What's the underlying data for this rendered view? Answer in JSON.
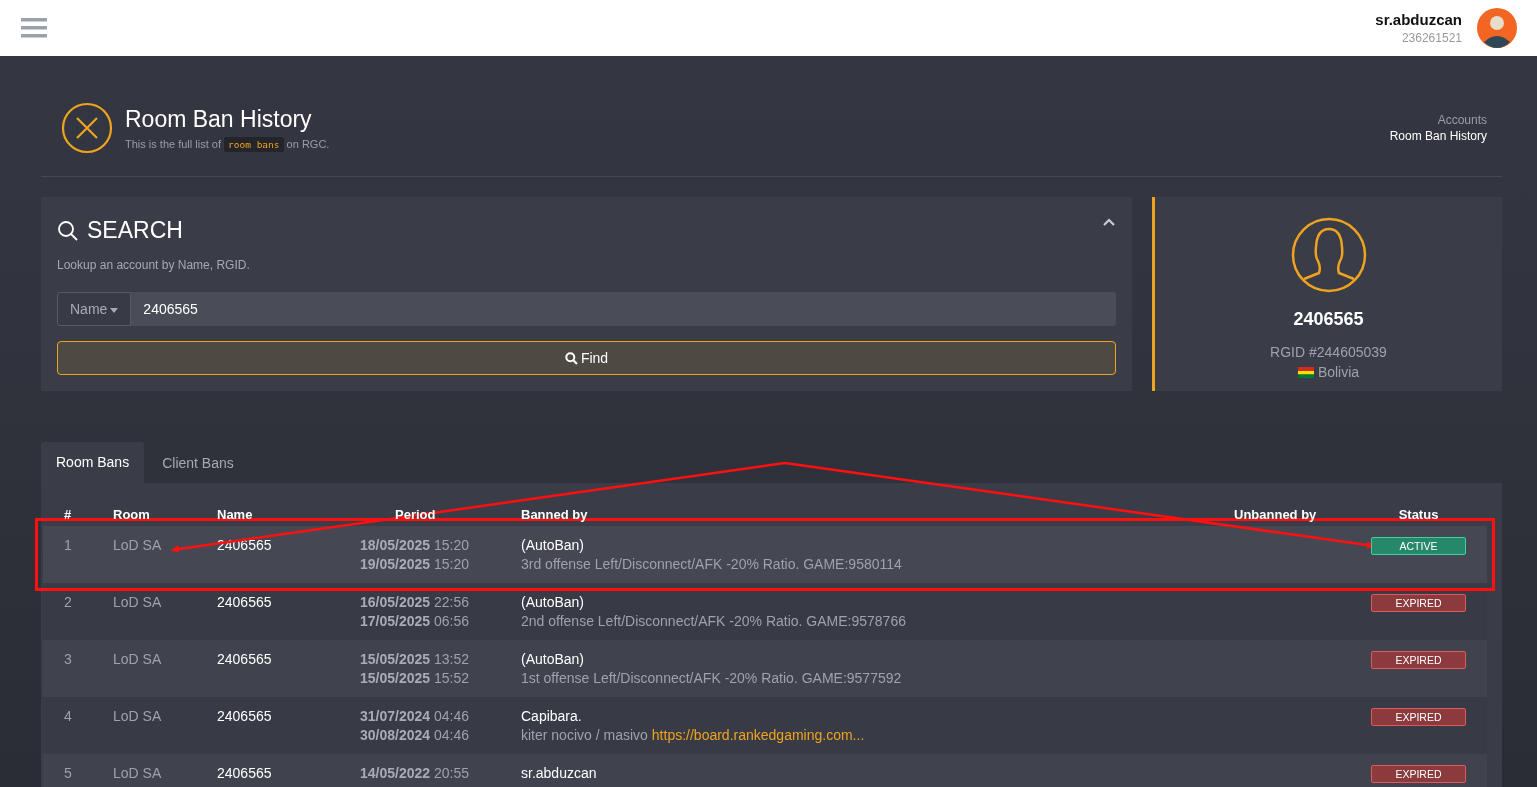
{
  "topbar": {
    "username": "sr.abduzcan",
    "user_id": "236261521"
  },
  "page": {
    "title": "Room Ban History",
    "subtitle_before": "This is the full list of",
    "subtitle_code": "room bans",
    "subtitle_after": "on RGC.",
    "breadcrumb": [
      "Accounts",
      "Room Ban History"
    ]
  },
  "search": {
    "title": "SEARCH",
    "hint": "Lookup an account by Name, RGID.",
    "field_type": "Name",
    "value": "2406565",
    "button": "Find",
    "expanded": true
  },
  "profile": {
    "name": "2406565",
    "rgid": "RGID #244605039",
    "country": "Bolivia"
  },
  "tabs": [
    {
      "label": "Room Bans",
      "selected": true
    },
    {
      "label": "Client Bans",
      "selected": false
    }
  ],
  "table": {
    "columns": [
      "#",
      "Room",
      "Name",
      "Period",
      "Banned by",
      "Unbanned by",
      "Status"
    ],
    "rows": [
      {
        "num": "1",
        "room": "LoD SA",
        "name": "2406565",
        "start": "**18/05/2025** 15:20",
        "end": "**19/05/2025** 15:20",
        "banned_by": "(AutoBan)",
        "reason": "3rd offense Left/Disconnect/AFK -20% Ratio. GAME:9580114",
        "status": "ACTIVE",
        "highlighted": true
      },
      {
        "num": "2",
        "room": "LoD SA",
        "name": "2406565",
        "start": "**16/05/2025** 22:56",
        "end": "**17/05/2025** 06:56",
        "banned_by": "(AutoBan)",
        "reason": "2nd offense Left/Disconnect/AFK -20% Ratio. GAME:9578766",
        "status": "EXPIRED",
        "highlighted": false
      },
      {
        "num": "3",
        "room": "LoD SA",
        "name": "2406565",
        "start": "**15/05/2025** 13:52",
        "end": "**15/05/2025** 15:52",
        "banned_by": "(AutoBan)",
        "reason": "1st offense Left/Disconnect/AFK -20% Ratio. GAME:9577592",
        "status": "EXPIRED",
        "highlighted": false
      },
      {
        "num": "4",
        "room": "LoD SA",
        "name": "2406565",
        "start": "**31/07/2024** 04:46",
        "end": "**30/08/2024** 04:46",
        "banned_by": "Capibara.",
        "reason": "kiter nocivo / masivo",
        "link": "https://board.rankedgaming.com...",
        "status": "EXPIRED",
        "highlighted": false
      },
      {
        "num": "5",
        "room": "LoD SA",
        "name": "2406565",
        "start": "**14/05/2022** 20:55",
        "banned_by": "sr.abduzcan",
        "status": "EXPIRED",
        "highlighted": false
      }
    ]
  }
}
